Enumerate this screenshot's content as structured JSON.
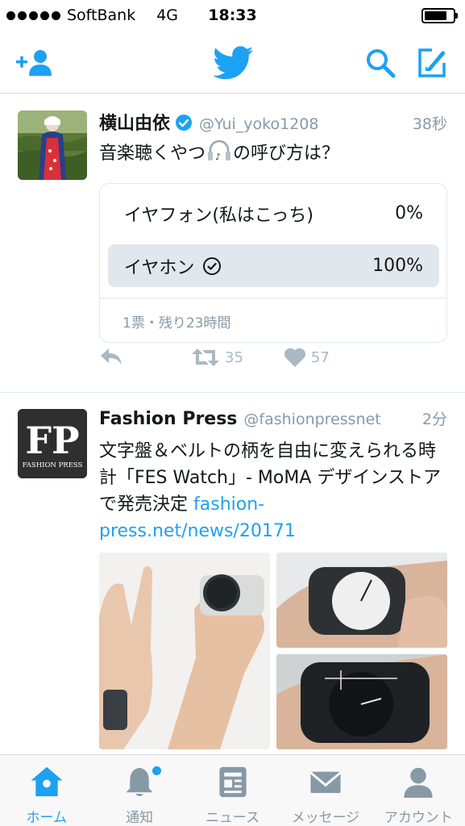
{
  "status_bar": {
    "carrier": "SoftBank",
    "network": "4G",
    "time": "18:33",
    "battery_level": 0.8
  },
  "nav": {
    "icons": [
      "add-user-icon",
      "twitter-bird-icon",
      "search-icon",
      "compose-icon"
    ],
    "accent": "#1da1f2"
  },
  "tweets": [
    {
      "name": "横山由依",
      "handle": "@Yui_yoko1208",
      "time": "38秒",
      "verified": true,
      "text_before": "音楽聴くやつ",
      "text_after": "の呼び方は？",
      "emoji_icon": "headphones-icon",
      "poll": {
        "options": [
          {
            "label": "イヤフォン(私はこっち)",
            "percent": "0%",
            "selected": false
          },
          {
            "label": "イヤホン",
            "percent": "100%",
            "selected": true
          }
        ],
        "footer": "1票・残り23時間"
      },
      "actions": {
        "retweets": "35",
        "likes": "57"
      }
    },
    {
      "name": "Fashion Press",
      "handle": "@fashionpressnet",
      "time": "2分",
      "avatar_text": "FP",
      "avatar_subtext": "FASHION PRESS",
      "text": "文字盤＆ベルトの柄を自由に変えられる時計「FES Watch」- MoMA デザインストアで発売決定 ",
      "link": "fashion-press.net/news/20171"
    }
  ],
  "tabs": [
    {
      "label": "ホーム",
      "icon": "home-icon",
      "active": true
    },
    {
      "label": "通知",
      "icon": "bell-icon",
      "active": false
    },
    {
      "label": "ニュース",
      "icon": "news-icon",
      "active": false
    },
    {
      "label": "メッセージ",
      "icon": "envelope-icon",
      "active": false
    },
    {
      "label": "アカウント",
      "icon": "person-icon",
      "active": false
    }
  ]
}
